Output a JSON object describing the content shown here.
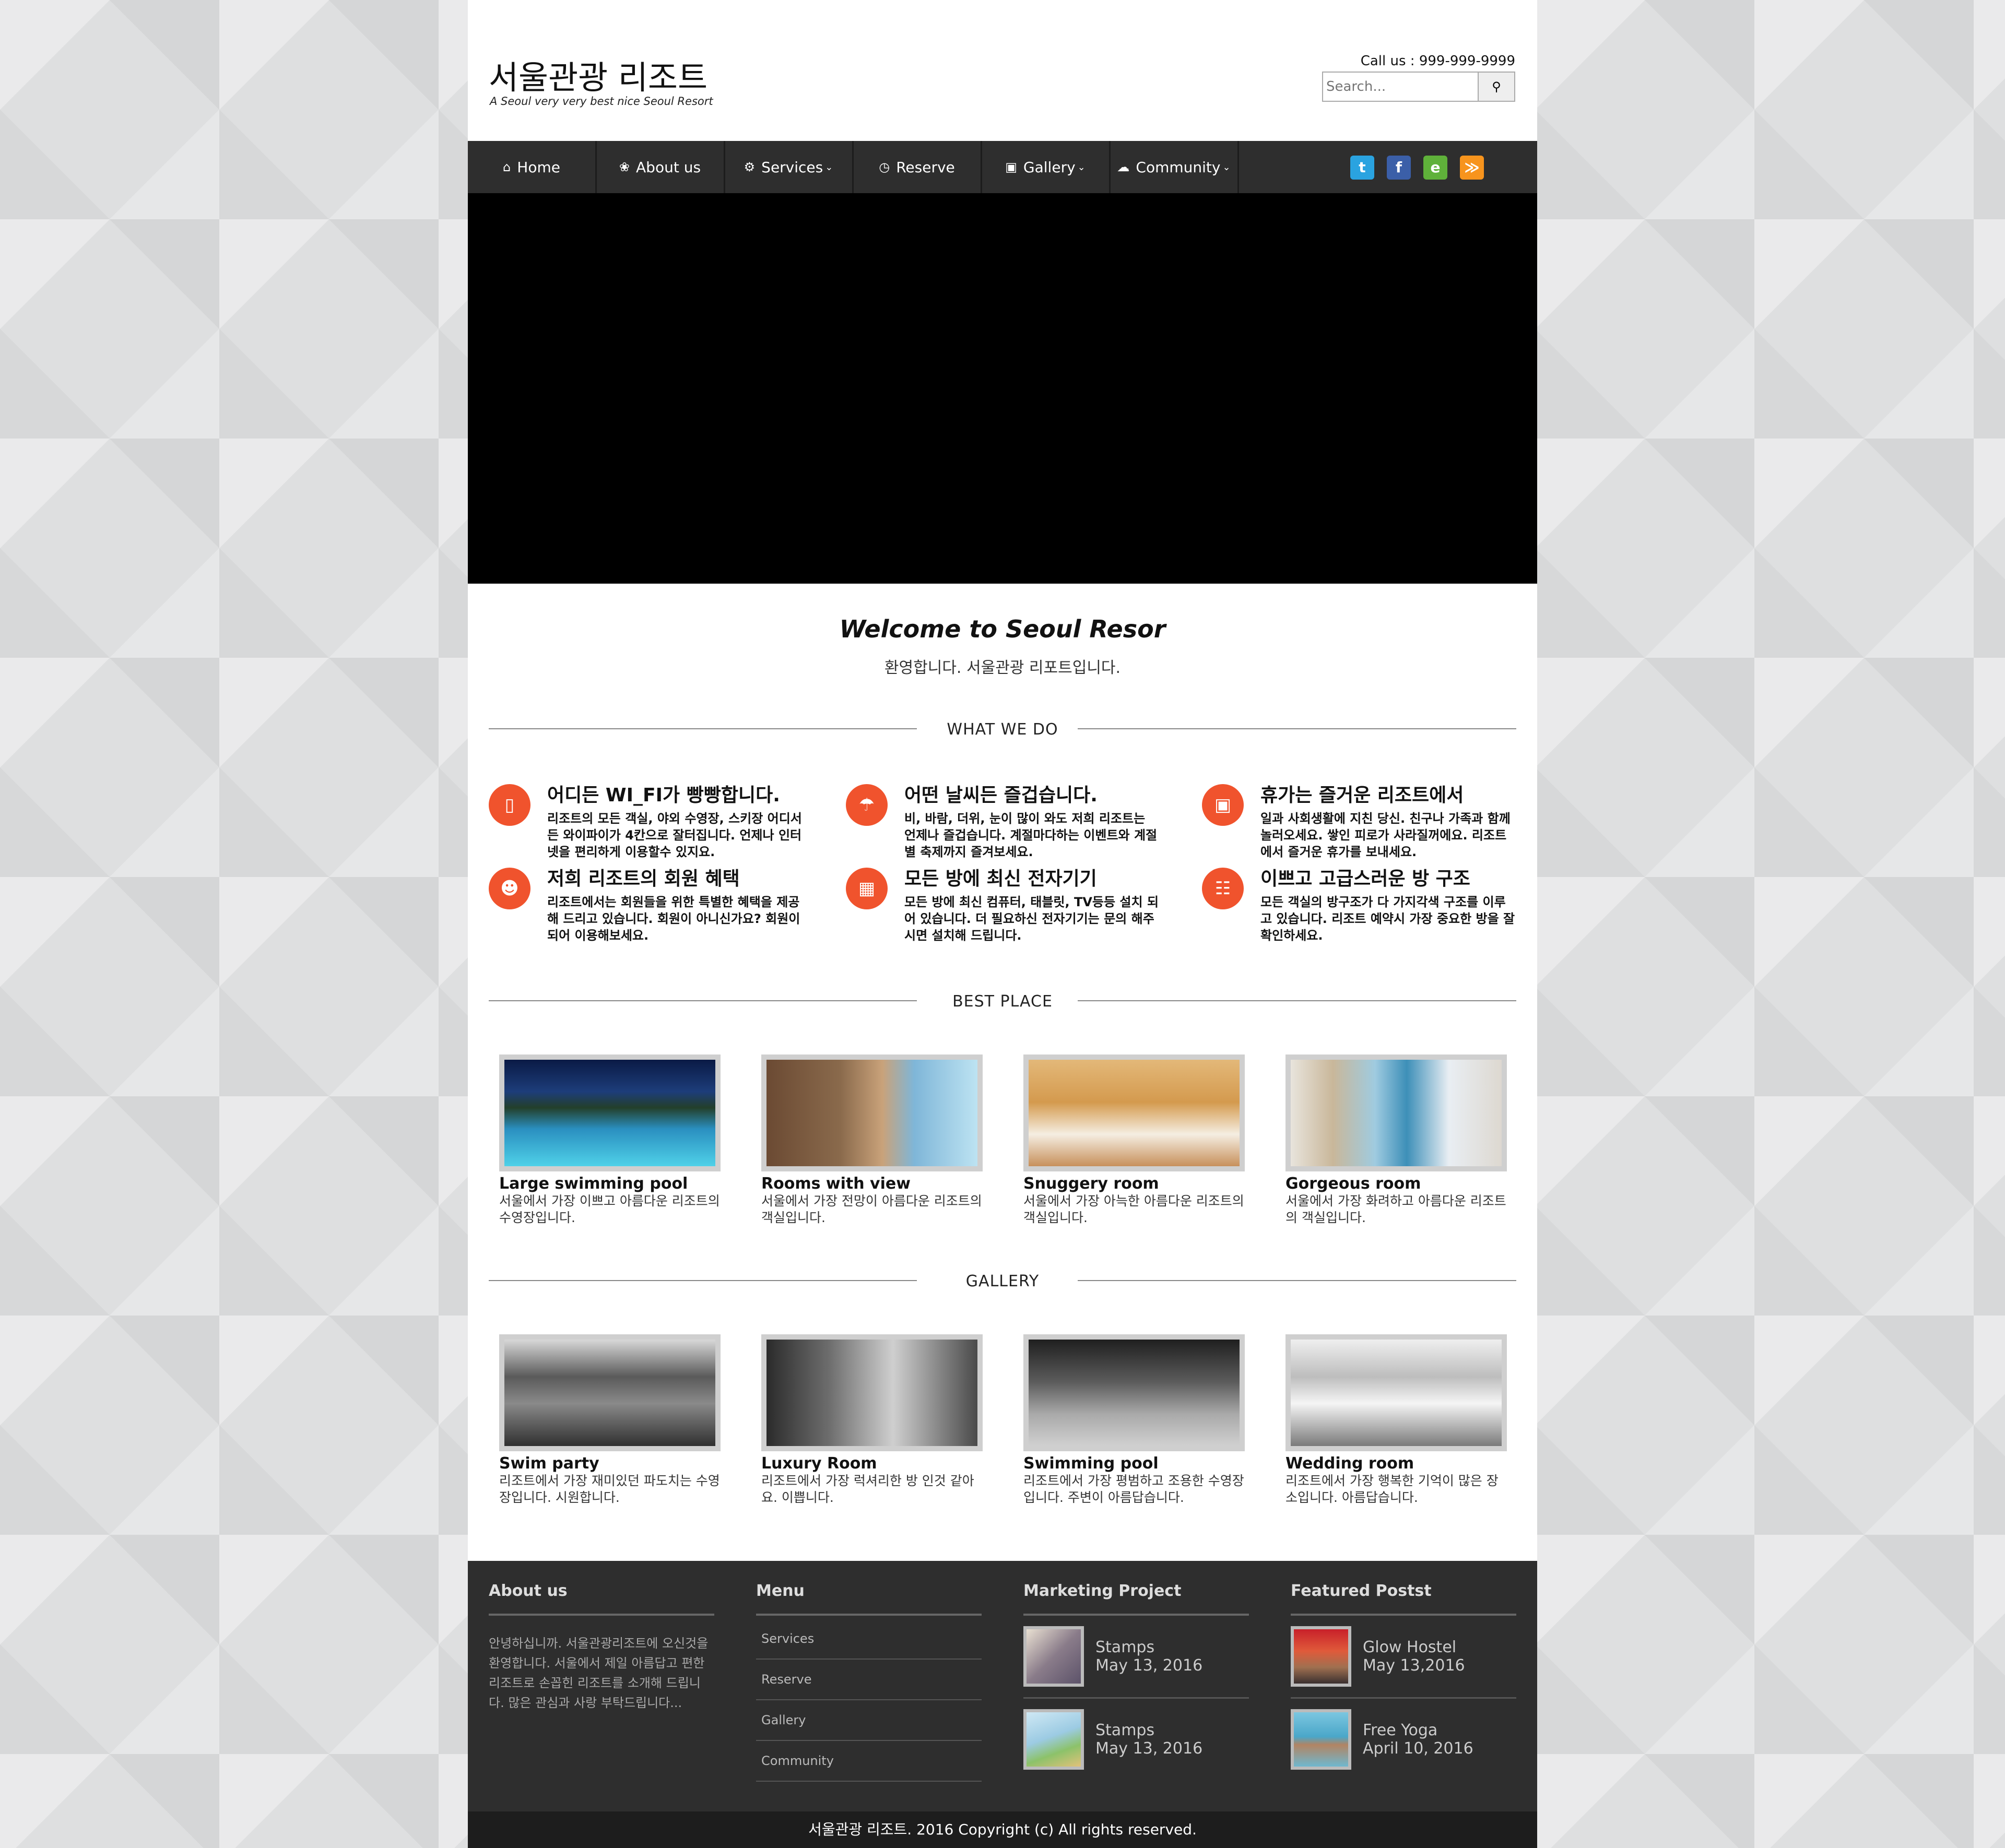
{
  "header": {
    "title": "서울관광 리조트",
    "subtitle": "A Seoul very very best nice Seoul Resort",
    "call": "Call us : 999-999-9999",
    "search_placeholder": "Search..."
  },
  "nav": {
    "items": [
      {
        "label": "Home",
        "icon": "home-icon"
      },
      {
        "label": "About us",
        "icon": "leaf-icon"
      },
      {
        "label": "Services",
        "icon": "gear-icon",
        "dropdown": true
      },
      {
        "label": "Reserve",
        "icon": "clock-icon"
      },
      {
        "label": "Gallery",
        "icon": "image-icon",
        "dropdown": true
      },
      {
        "label": "Community",
        "icon": "chat-icon",
        "dropdown": true
      }
    ],
    "social": [
      {
        "name": "twitter-icon",
        "glyph": "t",
        "color": "#2aa3e0"
      },
      {
        "name": "facebook-icon",
        "glyph": "f",
        "color": "#3b5fa8"
      },
      {
        "name": "evernote-icon",
        "glyph": "e",
        "color": "#5fb13a"
      },
      {
        "name": "rss-icon",
        "glyph": "r",
        "color": "#f7941d"
      }
    ]
  },
  "welcome": {
    "title": "Welcome to Seoul Resor",
    "subtitle": "환영합니다. 서울관광 리포트입니다."
  },
  "sections": {
    "what_we_do": "WHAT WE DO",
    "best_place": "BEST PLACE",
    "gallery": "GALLERY"
  },
  "features": [
    {
      "icon": "mobile-icon",
      "title": "어디든 WI_FI가 빵빵합니다.",
      "text": "리조트의 모든 객실, 야외 수영장, 스키장 어디서든 와이파이가 4칸으로 잘터집니다. 언제나 인터넷을 편리하게 이용할수 있지요."
    },
    {
      "icon": "umbrella-icon",
      "title": "어떤 날씨든 즐겁습니다.",
      "text": "비, 바람, 더위, 눈이 많이 와도 저희 리조트는 언제나 즐겁습니다. 계절마다하는 이벤트와 계절별 축제까지 즐겨보세요."
    },
    {
      "icon": "briefcase-icon",
      "title": "휴가는 즐거운 리조트에서",
      "text": "일과 사회생활에 지친 당신. 친구나 가족과 함께 놀러오세요. 쌓인 피로가 사라질꺼에요. 리조트에서 즐거운 휴가를 보내세요."
    },
    {
      "icon": "user-icon",
      "title": "저희 리조트의 회원 혜택",
      "text": "리조트에서는 회원들을 위한 특별한 혜택을 제공해 드리고 있습니다. 회원이 아니신가요? 회원이 되어 이용해보세요."
    },
    {
      "icon": "windows-icon",
      "title": "모든 방에 최신 전자기기",
      "text": "모든 방에 최신 컴퓨터, 태블릿, TV등등 설치 되어 있습니다. 더 필요하신 전자기기는 문의 해주시면 설치해 드립니다."
    },
    {
      "icon": "sitemap-icon",
      "title": "이쁘고 고급스러운 방 구조",
      "text": "모든 객실의 방구조가 다 가지각색 구조를 이루고 있습니다. 리조트 예약시 가장 중요한 방을 잘 확인하세요."
    }
  ],
  "best_place": [
    {
      "title": "Large swimming pool",
      "text": "서울에서 가장 이쁘고 아름다운 리조트의 수영장입니다."
    },
    {
      "title": "Rooms with view",
      "text": "서울에서 가장 전망이 아름다운 리조트의 객실입니다."
    },
    {
      "title": "Snuggery room",
      "text": "서울에서 가장 아늑한 아름다운 리조트의 객실입니다."
    },
    {
      "title": "Gorgeous room",
      "text": "서울에서 가장 화려하고 아름다운 리조트의 객실입니다."
    }
  ],
  "gallery": [
    {
      "title": "Swim party",
      "text": "리조트에서 가장 재미있던 파도치는 수영장입니다. 시원합니다."
    },
    {
      "title": "Luxury Room",
      "text": "리조트에서 가장 럭셔리한 방 인것 같아요. 이쁩니다."
    },
    {
      "title": "Swimming pool",
      "text": "리조트에서 가장 평범하고 조용한 수영장입니다. 주변이 아름답습니다."
    },
    {
      "title": "Wedding room",
      "text": "리조트에서 가장 행복한 기억이 많은 장소입니다. 아름답습니다."
    }
  ],
  "footer": {
    "about_title": "About us",
    "about_text": "안녕하십니까. 서울관광리조트에 오신것을 환영합니다. 서울에서 제일 아름답고 편한 리조트로 손꼽힌 리조트를 소개해 드립니다. 많은 관심과 사랑 부탁드립니다...",
    "menu_title": "Menu",
    "menu_items": [
      "Services",
      "Reserve",
      "Gallery",
      "Community"
    ],
    "marketing_title": "Marketing Project",
    "marketing": [
      {
        "title": "Stamps",
        "date": "May 13, 2016"
      },
      {
        "title": "Stamps",
        "date": "May 13, 2016"
      }
    ],
    "featured_title": "Featured Postst",
    "featured": [
      {
        "title": "Glow Hostel",
        "date": "May 13,2016"
      },
      {
        "title": "Free Yoga",
        "date": "April 10, 2016"
      }
    ],
    "copyright": "서울관광 리조트. 2016 Copyright (c) All rights reserved."
  }
}
